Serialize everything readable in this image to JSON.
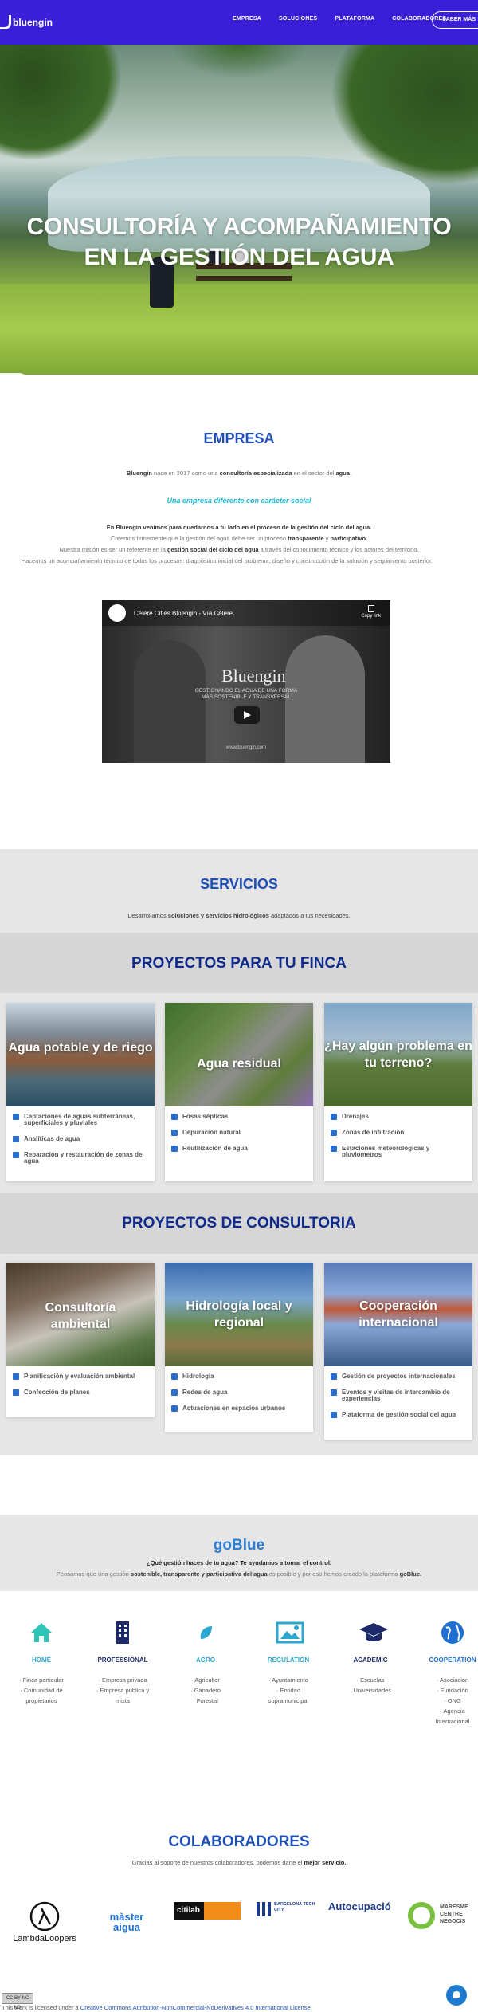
{
  "header": {
    "logo_text": "bluengin",
    "nav": [
      "EMPRESA",
      "SOLUCIONES",
      "PLATAFORMA",
      "COLABORADORES"
    ],
    "cta": "SABER MÁS"
  },
  "hero": {
    "title_line1": "CONSULTORÍA Y ACOMPAÑAMIENTO",
    "title_line2": "EN LA GESTIÓN DEL AGUA"
  },
  "empresa": {
    "title": "EMPRESA",
    "intro_brand": "Bluengin",
    "intro_mid": " nace en 2017 como una ",
    "intro_bold": "consultoría especializada",
    "intro_end1": " en el sector del ",
    "intro_bold2": "agua",
    "intro_end2": ".",
    "tagline": "Una empresa diferente con carácter social",
    "p1": "En Bluengin venimos para quedarnos a tu lado en el proceso de la gestión del ciclo del agua.",
    "p2a": "Creemos firmemente que la gestión del agua debe ser un proceso ",
    "p2b": "transparente",
    "p2c": " y ",
    "p2d": "participativo.",
    "p3a": "Nuestra misión es ser un referente en la ",
    "p3b": "gestión social del ciclo del agua",
    "p3c": " a través del conocimiento técnico y los actores del territorio.",
    "p4": "Hacemos un acompañamiento técnico de todos los procesos: diagnóstico inicial del problema, diseño y construcción de la solución y seguimiento posterior."
  },
  "video": {
    "title": "Célere Cities Bluengin - Vía Célere",
    "copy": "Copy link",
    "brand": "Bluengin",
    "sub1": "GESTIONANDO EL AGUA DE UNA FORMA",
    "sub2": "MÁS SOSTENIBLE Y TRANSVERSAL",
    "url": "www.bluengin.com"
  },
  "servicios": {
    "title": "SERVICIOS",
    "desc_a": "Desarrollamos ",
    "desc_b": "soluciones y servicios hidrológicos",
    "desc_c": " adaptados a tus necesidades."
  },
  "finca": {
    "title": "PROYECTOS PARA TU FINCA",
    "cards": [
      {
        "caption": "Agua potable y de riego",
        "items": [
          "Captaciones de aguas subterráneas, superficiales y pluviales",
          "Analíticas de agua",
          "Reparación y restauración de zonas de agua"
        ]
      },
      {
        "caption": "Agua residual",
        "items": [
          "Fosas sépticas",
          "Depuración natural",
          "Reutilización de agua"
        ]
      },
      {
        "caption": "¿Hay algún problema en tu terreno?",
        "items": [
          "Drenajes",
          "Zonas de infiltración",
          "Estaciones meteorológicas y pluviómetros"
        ]
      }
    ]
  },
  "consultoria": {
    "title": "PROYECTOS DE CONSULTORIA",
    "cards": [
      {
        "caption": "Consultoría ambiental",
        "items": [
          "Planificación y evaluación ambiental",
          "Confección de planes"
        ]
      },
      {
        "caption": "Hidrología local y regional",
        "items": [
          "Hidrología",
          "Redes de agua",
          "Actuaciones en espacios urbanos"
        ]
      },
      {
        "caption": "Cooperación internacional",
        "items": [
          "Gestión de proyectos internacionales",
          "Eventos y visitas de intercambio de experiencias",
          "Plataforma de gestión social del agua"
        ]
      }
    ]
  },
  "goblue": {
    "title": "goBlue",
    "question": "¿Qué gestión haces de tu agua? Te ayudamos a tomar el control.",
    "desc_a": "Pensamos que una gestión ",
    "desc_b": "sostenible, transparente y participativa del agua",
    "desc_c": " es posible y por eso hemos creado la plataforma ",
    "desc_d": "goBlue."
  },
  "categories": [
    {
      "label": "HOME",
      "items": [
        "· Finca particular",
        "· Comunidad de",
        "propietarios"
      ],
      "icon": "home-icon"
    },
    {
      "label": "PROFESSIONAL",
      "items": [
        "· Empresa privada",
        "· Empresa pública y",
        "mixta"
      ],
      "icon": "building-icon"
    },
    {
      "label": "AGRO",
      "items": [
        "· Agricultor",
        "· Ganadero",
        "· Forestal"
      ],
      "icon": "leaf-icon"
    },
    {
      "label": "REGULATION",
      "items": [
        "· Ayuntamiento",
        "· Entidad",
        "supramunicipal"
      ],
      "icon": "image-icon"
    },
    {
      "label": "ACADEMIC",
      "items": [
        "· Escuelas",
        "· Universidades"
      ],
      "icon": "graduation-cap-icon"
    },
    {
      "label": "COOPERATION",
      "items": [
        "· Asociación",
        "· Fundación",
        "· ONG",
        "· Agencia",
        "Internacional"
      ],
      "icon": "globe-icon"
    }
  ],
  "colaboradores": {
    "title": "COLABORADORES",
    "desc_a": "Gracias al soporte de nuestros colaboradores, podemos darte el ",
    "desc_b": "mejor servicio.",
    "logos": [
      "LambdaLoopers",
      "màster aigua",
      "citilab",
      "BARCELONA TECH CITY",
      "Autocupació",
      "MARESME CENTRE NEGOCIS"
    ]
  },
  "footer": {
    "cc": "CC BY NC ND",
    "text_a": "This work is licensed under a ",
    "link": "Creative Commons Attribution-NonCommercial-NoDerivatives 4.0 International License",
    "text_b": "."
  }
}
